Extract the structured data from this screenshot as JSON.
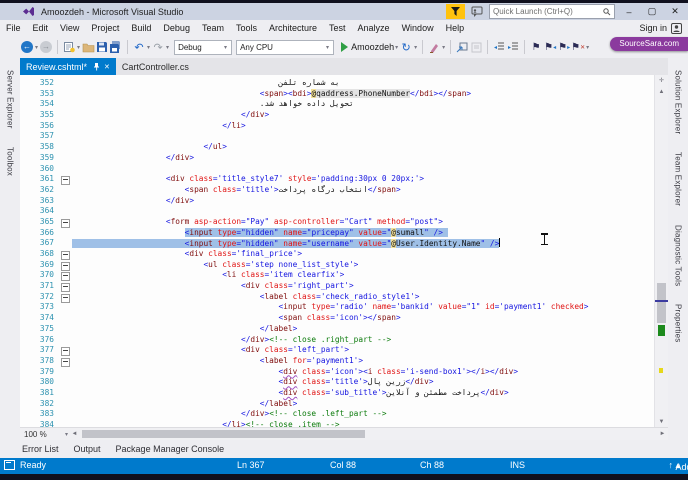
{
  "window": {
    "title": "Amoozdeh - Microsoft Visual Studio",
    "quick_launch_placeholder": "Quick Launch (Ctrl+Q)",
    "sign_in": "Sign in",
    "badge": "SourceSara.com",
    "minimize": "–",
    "maximize": "▢",
    "close": "✕"
  },
  "menu": {
    "items": [
      "File",
      "Edit",
      "View",
      "Project",
      "Build",
      "Debug",
      "Team",
      "Tools",
      "Architecture",
      "Test",
      "Analyze",
      "Window",
      "Help"
    ]
  },
  "toolbar": {
    "debug_config": "Debug",
    "platform": "Any CPU",
    "run_label": "Amoozdeh"
  },
  "tabs": [
    {
      "label": "Review.cshtml*",
      "active": true
    },
    {
      "label": "CartController.cs",
      "active": false
    }
  ],
  "left_panel_tabs": [
    "Server Explorer",
    "Toolbox"
  ],
  "right_panel_tabs": [
    "Solution Explorer",
    "Team Explorer",
    "Diagnostic Tools",
    "Properties"
  ],
  "bottom_tabs": [
    "Error List",
    "Output",
    "Package Manager Console"
  ],
  "status_bar": {
    "state": "Ready",
    "line": "Ln 367",
    "col": "Col 88",
    "ch": "Ch 88",
    "mode": "INS",
    "source_control": "Add to Source Control"
  },
  "editor": {
    "zoom": "100 %",
    "lines": [
      {
        "n": 352,
        "i": 44,
        "s": [
          [
            "t",
            "به شماره تلفن"
          ]
        ]
      },
      {
        "n": 353,
        "i": 40,
        "s": [
          [
            "d",
            "<"
          ],
          [
            "g",
            "span"
          ],
          [
            "d",
            "><"
          ],
          [
            "g",
            "bdi"
          ],
          [
            "d",
            ">"
          ],
          [
            "ra",
            "@"
          ],
          [
            "rc",
            "qaddress.PhoneNumber"
          ],
          [
            "d",
            "</"
          ],
          [
            "g",
            "bdi"
          ],
          [
            "d",
            "></"
          ],
          [
            "g",
            "span"
          ],
          [
            "d",
            ">"
          ]
        ]
      },
      {
        "n": 354,
        "i": 40,
        "s": [
          [
            "t",
            ".تحویل داده خواهد شد"
          ]
        ]
      },
      {
        "n": 355,
        "i": 36,
        "s": [
          [
            "d",
            "</"
          ],
          [
            "g",
            "div"
          ],
          [
            "d",
            ">"
          ]
        ]
      },
      {
        "n": 356,
        "i": 32,
        "s": [
          [
            "d",
            "</"
          ],
          [
            "g",
            "li"
          ],
          [
            "d",
            ">"
          ]
        ]
      },
      {
        "n": 357,
        "i": 0,
        "s": []
      },
      {
        "n": 358,
        "i": 28,
        "s": [
          [
            "d",
            "</"
          ],
          [
            "g",
            "ul"
          ],
          [
            "d",
            ">"
          ]
        ]
      },
      {
        "n": 359,
        "i": 20,
        "s": [
          [
            "d",
            "</"
          ],
          [
            "g",
            "div"
          ],
          [
            "d",
            ">"
          ]
        ]
      },
      {
        "n": 360,
        "i": 0,
        "s": []
      },
      {
        "n": 361,
        "i": 20,
        "f": 1,
        "s": [
          [
            "d",
            "<"
          ],
          [
            "g",
            "div"
          ],
          [
            "a",
            " class"
          ],
          [
            "v",
            "='title_style7'"
          ],
          [
            "a",
            " style"
          ],
          [
            "v",
            "='padding:30px 0 20px;'"
          ],
          [
            "d",
            ">"
          ]
        ]
      },
      {
        "n": 362,
        "i": 24,
        "s": [
          [
            "d",
            "<"
          ],
          [
            "g",
            "span"
          ],
          [
            "a",
            " class"
          ],
          [
            "v",
            "='title'"
          ],
          [
            "d",
            ">"
          ],
          [
            "t",
            "انتخاب درگاه پرداخت"
          ],
          [
            "d",
            "</"
          ],
          [
            "g",
            "span"
          ],
          [
            "d",
            ">"
          ]
        ]
      },
      {
        "n": 363,
        "i": 20,
        "s": [
          [
            "d",
            "</"
          ],
          [
            "g",
            "div"
          ],
          [
            "d",
            ">"
          ]
        ]
      },
      {
        "n": 364,
        "i": 0,
        "s": []
      },
      {
        "n": 365,
        "i": 20,
        "f": 1,
        "s": [
          [
            "d",
            "<"
          ],
          [
            "g",
            "form"
          ],
          [
            "a",
            " asp-action"
          ],
          [
            "v",
            "=\"Pay\""
          ],
          [
            "a",
            " asp-controller"
          ],
          [
            "v",
            "=\"Cart\""
          ],
          [
            "a",
            " method"
          ],
          [
            "v",
            "=\"post\""
          ],
          [
            "d",
            ">"
          ]
        ]
      },
      {
        "n": 366,
        "i": 24,
        "sel": "code",
        "s": [
          [
            "d",
            "<"
          ],
          [
            "g",
            "input"
          ],
          [
            "a",
            " type"
          ],
          [
            "v",
            "=\"hidden\""
          ],
          [
            "a",
            " name"
          ],
          [
            "v",
            "=\"pricepay\""
          ],
          [
            "a",
            " value"
          ],
          [
            "v",
            "=\""
          ],
          [
            "ra",
            "@"
          ],
          [
            "rc",
            "sumall"
          ],
          [
            "v",
            "\" "
          ],
          [
            "d",
            "/>"
          ]
        ]
      },
      {
        "n": 367,
        "i": 24,
        "sel": "full",
        "s": [
          [
            "d",
            "<"
          ],
          [
            "g",
            "input"
          ],
          [
            "a",
            " type"
          ],
          [
            "v",
            "=\"hidden\""
          ],
          [
            "a",
            " name"
          ],
          [
            "v",
            "=\"username\""
          ],
          [
            "a",
            " value"
          ],
          [
            "v",
            "=\""
          ],
          [
            "ra",
            "@"
          ],
          [
            "rc",
            "User.Identity.Name"
          ],
          [
            "v",
            "\" "
          ],
          [
            "d",
            "/>"
          ]
        ]
      },
      {
        "n": 368,
        "i": 24,
        "f": 1,
        "s": [
          [
            "d",
            "<"
          ],
          [
            "g",
            "div"
          ],
          [
            "a",
            " class"
          ],
          [
            "v",
            "='final_price'"
          ],
          [
            "d",
            ">"
          ]
        ]
      },
      {
        "n": 369,
        "i": 28,
        "f": 1,
        "s": [
          [
            "d",
            "<"
          ],
          [
            "g",
            "ul"
          ],
          [
            "a",
            " class"
          ],
          [
            "v",
            "='step none_list_style'"
          ],
          [
            "d",
            ">"
          ]
        ]
      },
      {
        "n": 370,
        "i": 32,
        "f": 1,
        "s": [
          [
            "d",
            "<"
          ],
          [
            "g",
            "li"
          ],
          [
            "a",
            " class"
          ],
          [
            "v",
            "='item clearfix'"
          ],
          [
            "d",
            ">"
          ]
        ]
      },
      {
        "n": 371,
        "i": 36,
        "f": 1,
        "s": [
          [
            "d",
            "<"
          ],
          [
            "g",
            "div"
          ],
          [
            "a",
            " class"
          ],
          [
            "v",
            "='right_part'"
          ],
          [
            "d",
            ">"
          ]
        ]
      },
      {
        "n": 372,
        "i": 40,
        "f": 1,
        "s": [
          [
            "d",
            "<"
          ],
          [
            "g",
            "label"
          ],
          [
            "a",
            " class"
          ],
          [
            "v",
            "='check_radio_style1'"
          ],
          [
            "d",
            ">"
          ]
        ]
      },
      {
        "n": 373,
        "i": 44,
        "s": [
          [
            "d",
            "<"
          ],
          [
            "g",
            "input"
          ],
          [
            "a",
            " type"
          ],
          [
            "v",
            "='radio'"
          ],
          [
            "a",
            " name"
          ],
          [
            "v",
            "='bankid'"
          ],
          [
            "a",
            " value"
          ],
          [
            "v",
            "=\"1\""
          ],
          [
            "a",
            " id"
          ],
          [
            "v",
            "='payment1'"
          ],
          [
            "a",
            " checked"
          ],
          [
            "d",
            ">"
          ]
        ]
      },
      {
        "n": 374,
        "i": 44,
        "s": [
          [
            "d",
            "<"
          ],
          [
            "g",
            "span"
          ],
          [
            "a",
            " class"
          ],
          [
            "v",
            "='icon'"
          ],
          [
            "d",
            "></"
          ],
          [
            "g",
            "span"
          ],
          [
            "d",
            ">"
          ]
        ]
      },
      {
        "n": 375,
        "i": 40,
        "s": [
          [
            "d",
            "</"
          ],
          [
            "g",
            "label"
          ],
          [
            "d",
            ">"
          ]
        ]
      },
      {
        "n": 376,
        "i": 36,
        "s": [
          [
            "d",
            "</"
          ],
          [
            "g",
            "div"
          ],
          [
            "d",
            ">"
          ],
          [
            "c",
            "<!-- close .right_part -->"
          ]
        ]
      },
      {
        "n": 377,
        "i": 36,
        "f": 1,
        "s": [
          [
            "d",
            "<"
          ],
          [
            "g",
            "div"
          ],
          [
            "a",
            " class"
          ],
          [
            "v",
            "='left_part'"
          ],
          [
            "d",
            ">"
          ]
        ]
      },
      {
        "n": 378,
        "i": 40,
        "f": 1,
        "s": [
          [
            "d",
            "<"
          ],
          [
            "g",
            "label"
          ],
          [
            "a",
            " for"
          ],
          [
            "v",
            "='payment1'"
          ],
          [
            "d",
            ">"
          ]
        ]
      },
      {
        "n": 379,
        "i": 44,
        "s": [
          [
            "d",
            "<"
          ],
          [
            "gq",
            "div"
          ],
          [
            "a",
            " class"
          ],
          [
            "v",
            "='icon'"
          ],
          [
            "d",
            "><"
          ],
          [
            "g",
            "i"
          ],
          [
            "a",
            " class"
          ],
          [
            "v",
            "='i-send-box1'"
          ],
          [
            "d",
            "></"
          ],
          [
            "g",
            "i"
          ],
          [
            "d",
            "></"
          ],
          [
            "g",
            "div"
          ],
          [
            "d",
            ">"
          ]
        ]
      },
      {
        "n": 380,
        "i": 44,
        "s": [
          [
            "d",
            "<"
          ],
          [
            "gq",
            "div"
          ],
          [
            "a",
            " class"
          ],
          [
            "v",
            "='title'"
          ],
          [
            "d",
            ">"
          ],
          [
            "t",
            "زرین پال"
          ],
          [
            "d",
            "</"
          ],
          [
            "g",
            "div"
          ],
          [
            "d",
            ">"
          ]
        ]
      },
      {
        "n": 381,
        "i": 44,
        "s": [
          [
            "d",
            "<"
          ],
          [
            "gq",
            "div"
          ],
          [
            "a",
            " class"
          ],
          [
            "v",
            "='sub_title'"
          ],
          [
            "d",
            ">"
          ],
          [
            "t",
            "پرداخت مطمئن و آنلاین"
          ],
          [
            "d",
            "</"
          ],
          [
            "g",
            "div"
          ],
          [
            "d",
            ">"
          ]
        ]
      },
      {
        "n": 382,
        "i": 40,
        "s": [
          [
            "d",
            "</"
          ],
          [
            "g",
            "label"
          ],
          [
            "d",
            ">"
          ]
        ]
      },
      {
        "n": 383,
        "i": 36,
        "s": [
          [
            "d",
            "</"
          ],
          [
            "g",
            "div"
          ],
          [
            "d",
            ">"
          ],
          [
            "c",
            "<!-- close .left_part -->"
          ]
        ]
      },
      {
        "n": 384,
        "i": 32,
        "s": [
          [
            "d",
            "</"
          ],
          [
            "g",
            "li"
          ],
          [
            "d",
            ">"
          ],
          [
            "c",
            "<!-- close .item -->"
          ]
        ]
      }
    ]
  },
  "colors": {
    "accent": "#007ACC",
    "selection": "#3399FF",
    "line_number": "#2B91AF",
    "tag": "#800000",
    "attribute": "#FF0000",
    "value": "#0000FF",
    "comment": "#008000",
    "badge": "#8B3A9E",
    "razor_at_bg": "#F3E19A"
  }
}
